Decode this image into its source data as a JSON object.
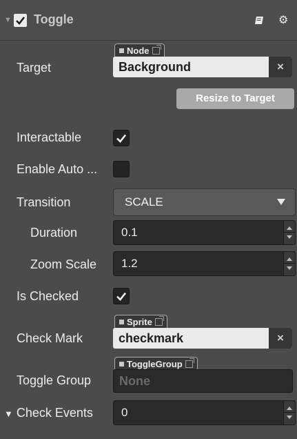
{
  "header": {
    "title": "Toggle",
    "enabled": true
  },
  "icons": {
    "collapse": "collapse-arrow-icon",
    "enable_check": "checkmark-icon",
    "manual": "book-icon",
    "settings": "gear-icon"
  },
  "props": {
    "target": {
      "label": "Target",
      "type_tag": "Node",
      "value": "Background",
      "clear": "×"
    },
    "resize_button": "Resize to Target",
    "interactable": {
      "label": "Interactable",
      "checked": true
    },
    "enable_auto": {
      "label": "Enable Auto ...",
      "checked": false
    },
    "transition": {
      "label": "Transition",
      "value": "SCALE"
    },
    "duration": {
      "label": "Duration",
      "value": "0.1"
    },
    "zoom_scale": {
      "label": "Zoom Scale",
      "value": "1.2"
    },
    "is_checked": {
      "label": "Is Checked",
      "checked": true
    },
    "check_mark": {
      "label": "Check Mark",
      "type_tag": "Sprite",
      "value": "checkmark",
      "clear": "×"
    },
    "toggle_group": {
      "label": "Toggle Group",
      "type_tag": "ToggleGroup",
      "value": "None"
    },
    "check_events": {
      "label": "Check Events",
      "value": "0"
    }
  },
  "colors": {
    "panel_bg": "#4b4b4b",
    "field_dark": "#2a2a2a",
    "field_light": "#eaeaea",
    "button": "#a9a9a9"
  }
}
